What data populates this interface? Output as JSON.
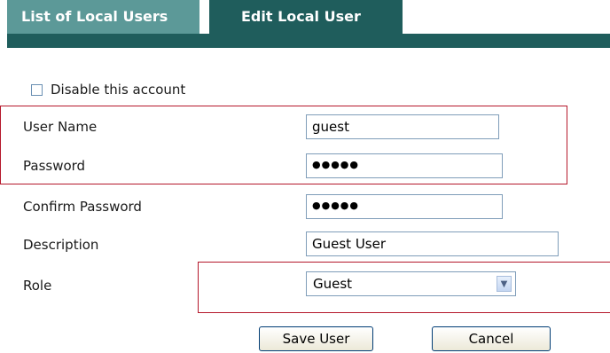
{
  "tabs": {
    "list_label": "List of Local Users",
    "edit_label": "Edit Local User"
  },
  "form": {
    "disable_label": "Disable this account",
    "username_label": "User Name",
    "username_value": "guest",
    "password_label": "Password",
    "password_value": "●●●●●",
    "confirm_label": "Confirm Password",
    "confirm_value": "●●●●●",
    "description_label": "Description",
    "description_value": "Guest User",
    "role_label": "Role",
    "role_value": "Guest"
  },
  "buttons": {
    "save_label": "Save User",
    "cancel_label": "Cancel"
  },
  "colors": {
    "tab_active": "#1f5d5c",
    "tab_inactive": "#5c9998",
    "highlight": "#b5182b"
  }
}
